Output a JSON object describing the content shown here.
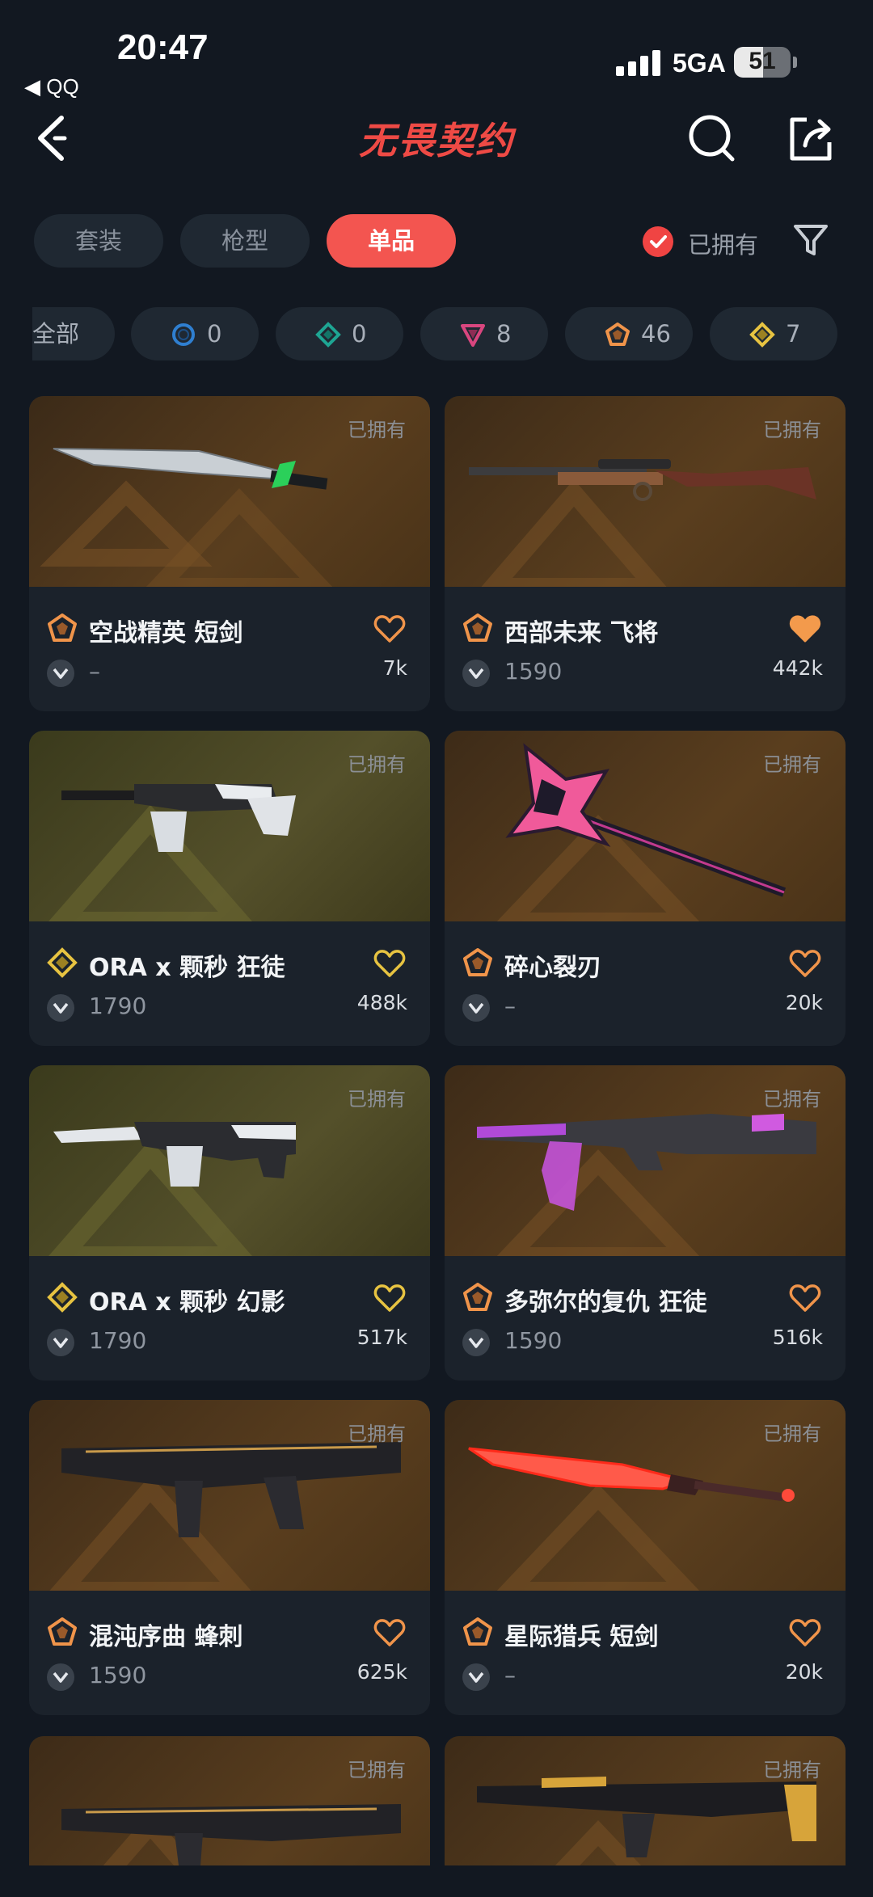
{
  "status_bar": {
    "time": "20:47",
    "back_app": "◀ QQ",
    "network": "5GA",
    "battery": "51",
    "battery_fraction": 0.51
  },
  "header": {
    "logo_text": "无畏契约"
  },
  "tabs": [
    {
      "label": "套装"
    },
    {
      "label": "枪型"
    },
    {
      "label": "单品",
      "active": true
    }
  ],
  "owned_filter": {
    "label": "已拥有",
    "checked": true
  },
  "tier_chips": [
    {
      "label": "全部",
      "count": ""
    },
    {
      "tier": "select",
      "count": "0",
      "color": "#2f7fd0"
    },
    {
      "tier": "deluxe",
      "count": "0",
      "color": "#1ea593"
    },
    {
      "tier": "premium",
      "count": "8",
      "color": "#d9467f"
    },
    {
      "tier": "exclusive",
      "count": "46",
      "color": "#f0944a"
    },
    {
      "tier": "ultra",
      "count": "7",
      "color": "#e7c341"
    }
  ],
  "cards": [
    {
      "owned_label": "已拥有",
      "name": "空战精英 短剑",
      "price": "–",
      "likes": "7k",
      "tier_color": "#f0944a",
      "liked": false,
      "heart_color": "#f0944a",
      "icon": "knife-icon"
    },
    {
      "owned_label": "已拥有",
      "name": "西部未来 飞将",
      "price": "1590",
      "likes": "442k",
      "tier_color": "#f0944a",
      "liked": true,
      "heart_color": "#f39a4c",
      "icon": "rifle-icon"
    },
    {
      "owned_label": "已拥有",
      "name": "ORA x 颗秒 狂徒",
      "price": "1790",
      "likes": "488k",
      "tier_color": "#e7c341",
      "liked": false,
      "heart_color": "#e7c341",
      "icon": "vandal-icon"
    },
    {
      "owned_label": "已拥有",
      "name": "碎心裂刃",
      "price": "–",
      "likes": "20k",
      "tier_color": "#f0944a",
      "liked": false,
      "heart_color": "#f0944a",
      "icon": "axe-icon"
    },
    {
      "owned_label": "已拥有",
      "name": "ORA x 颗秒 幻影",
      "price": "1790",
      "likes": "517k",
      "tier_color": "#e7c341",
      "liked": false,
      "heart_color": "#e7c341",
      "icon": "phantom-icon"
    },
    {
      "owned_label": "已拥有",
      "name": "多弥尔的复仇 狂徒",
      "price": "1590",
      "likes": "516k",
      "tier_color": "#f0944a",
      "liked": false,
      "heart_color": "#f0944a",
      "icon": "vandal-icon"
    },
    {
      "owned_label": "已拥有",
      "name": "混沌序曲 蜂刺",
      "price": "1590",
      "likes": "625k",
      "tier_color": "#f0944a",
      "liked": false,
      "heart_color": "#f0944a",
      "icon": "smg-icon"
    },
    {
      "owned_label": "已拥有",
      "name": "星际猎兵 短剑",
      "price": "–",
      "likes": "20k",
      "tier_color": "#f0944a",
      "liked": false,
      "heart_color": "#f0944a",
      "icon": "knife-icon"
    },
    {
      "owned_label": "已拥有",
      "partial": true,
      "icon": "smg-icon"
    },
    {
      "owned_label": "已拥有",
      "partial": true,
      "icon": "rifle-icon"
    }
  ]
}
